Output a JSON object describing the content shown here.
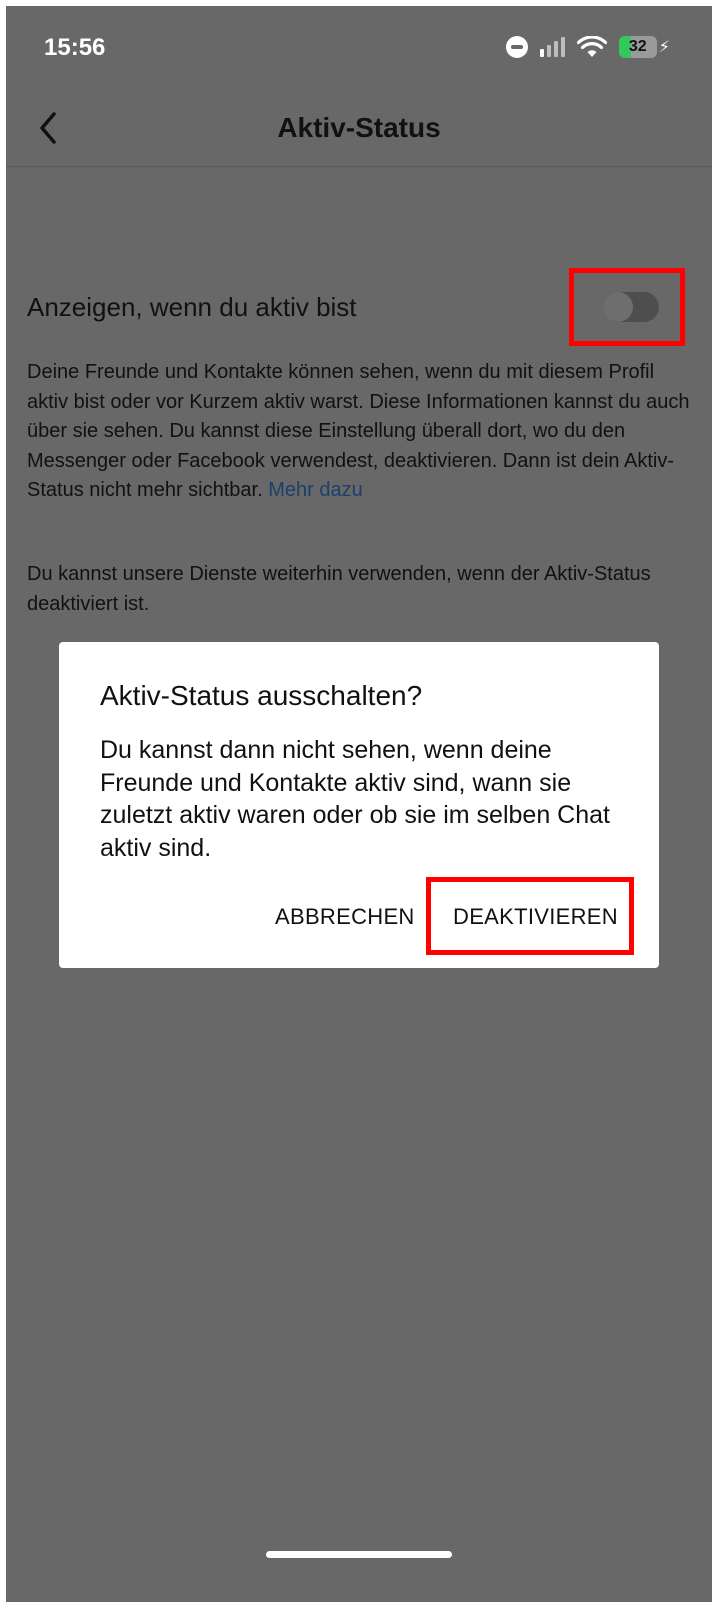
{
  "status_bar": {
    "time": "15:56",
    "battery_level": "32",
    "icons": [
      "do-not-disturb-icon",
      "cellular-signal-icon",
      "wifi-icon",
      "battery-icon",
      "charging-bolt-icon"
    ]
  },
  "header": {
    "title": "Aktiv-Status",
    "back_icon": "chevron-left-icon"
  },
  "setting": {
    "label": "Anzeigen, wenn du aktiv bist",
    "toggle_on": false,
    "description": "Deine Freunde und Kontakte können sehen, wenn du mit diesem Profil aktiv bist oder vor Kurzem aktiv warst. Diese Informationen kannst du auch über sie sehen. Du kannst diese Einstellung überall dort, wo du den Messenger oder Facebook verwendest, deaktivieren. Dann ist dein Aktiv-Status nicht mehr sichtbar.",
    "learn_more": "Mehr dazu",
    "note": "Du kannst unsere Dienste weiterhin verwenden, wenn der Aktiv-Status deaktiviert ist."
  },
  "dialog": {
    "title": "Aktiv-Status ausschalten?",
    "body": "Du kannst dann nicht sehen, wenn deine Freunde und Kontakte aktiv sind, wann sie zuletzt aktiv waren oder ob sie im selben Chat aktiv sind.",
    "cancel_label": "ABBRECHEN",
    "confirm_label": "DEAKTIVIEREN"
  },
  "colors": {
    "overlay_background": "#686868",
    "dialog_background": "#ffffff",
    "highlight": "#ff0000",
    "link": "#1b3f6e",
    "battery_fill": "#34c759"
  }
}
